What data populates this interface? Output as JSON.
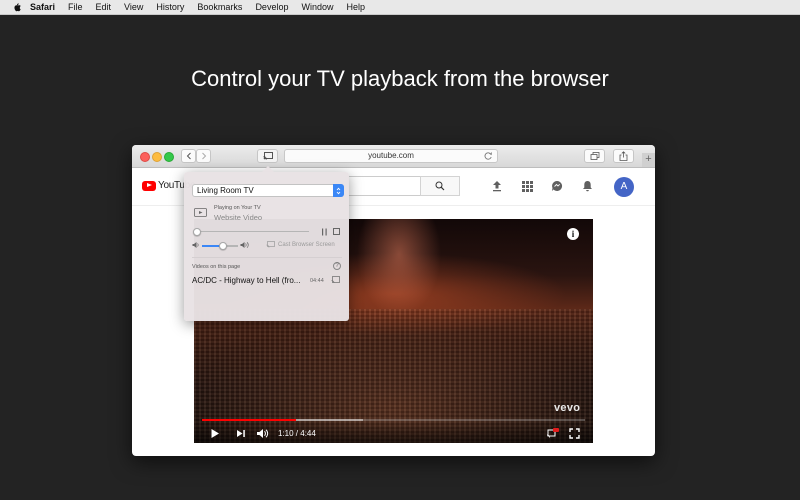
{
  "menubar": {
    "app": "Safari",
    "items": [
      "File",
      "Edit",
      "View",
      "History",
      "Bookmarks",
      "Develop",
      "Window",
      "Help"
    ]
  },
  "headline": "Control your TV playback from the browser",
  "browser": {
    "url": "youtube.com",
    "new_tab": "+"
  },
  "youtube": {
    "logo_text": "YouTube",
    "avatar_letter": "A",
    "brand_color": "#ff0000"
  },
  "video": {
    "time": "1:10 / 4:44",
    "watermark": "vevo",
    "info_label": "i",
    "progress_fraction": 0.246,
    "buffer_fraction": 0.42
  },
  "cast_popover": {
    "device": "Living Room TV",
    "playing_on": "Playing on Your TV",
    "playing_what": "Website Video",
    "position_fraction": 0.0,
    "volume_fraction": 0.55,
    "cast_screen_label": "Cast Browser Screen",
    "videos_label": "Videos on this page",
    "help": "?",
    "videos": [
      {
        "title": "AC/DC - Highway to Hell (fro...",
        "duration": "04:44"
      }
    ],
    "accent_color": "#3b87f6"
  }
}
